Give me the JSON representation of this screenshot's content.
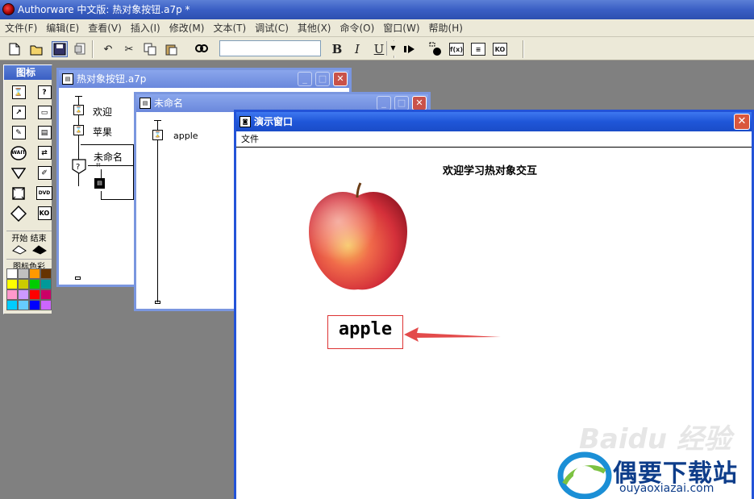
{
  "app": {
    "title": "Authorware 中文版: 热对象按钮.a7p *"
  },
  "menu": [
    "文件(F)",
    "编辑(E)",
    "查看(V)",
    "插入(I)",
    "修改(M)",
    "文本(T)",
    "调试(C)",
    "其他(X)",
    "命令(O)",
    "窗口(W)",
    "帮助(H)"
  ],
  "toolbar": {
    "bold": "B",
    "italic": "I",
    "underline": "U",
    "font_value": ""
  },
  "palette": {
    "title": "图标",
    "icons": [
      "display-icon",
      "help-icon",
      "motion-icon",
      "erase-icon",
      "calc-icon",
      "video-icon",
      "wait-icon",
      "framework-icon",
      "decision-icon",
      "interaction-icon",
      "calc-box-icon",
      "digital-movie-icon",
      "map-icon",
      "dvd-icon",
      "decision-diamond-icon",
      "knowledge-object-icon"
    ],
    "wait_text": "WAIT",
    "dvd_text": "DVD",
    "ko_text": "KO",
    "start_end": "开始 结束",
    "color_label": "图标色彩",
    "swatches": [
      "#ffffff",
      "#c0c0c0",
      "#ff9900",
      "#663300",
      "#ffff00",
      "#cccc00",
      "#00cc00",
      "#009999",
      "#ff99cc",
      "#cc99ff",
      "#ff0000",
      "#cc0066",
      "#00ccff",
      "#66ccff",
      "#0000ff",
      "#cc66ff"
    ]
  },
  "win1": {
    "title": "热对象按钮.a7p",
    "items": [
      {
        "label": "欢迎"
      },
      {
        "label": "苹果"
      },
      {
        "label": "未命名"
      }
    ],
    "decision_mark": "?"
  },
  "win2": {
    "title": "未命名",
    "items": [
      {
        "label": "apple"
      }
    ]
  },
  "presentation": {
    "title": "演示窗口",
    "menu": "文件",
    "heading": "欢迎学习热对象交互",
    "hot_object_label": "apple"
  },
  "watermark": {
    "brand": "偶要下载站",
    "url": "ouyaoxiazai.com",
    "baidu": "Baidu 经验"
  }
}
